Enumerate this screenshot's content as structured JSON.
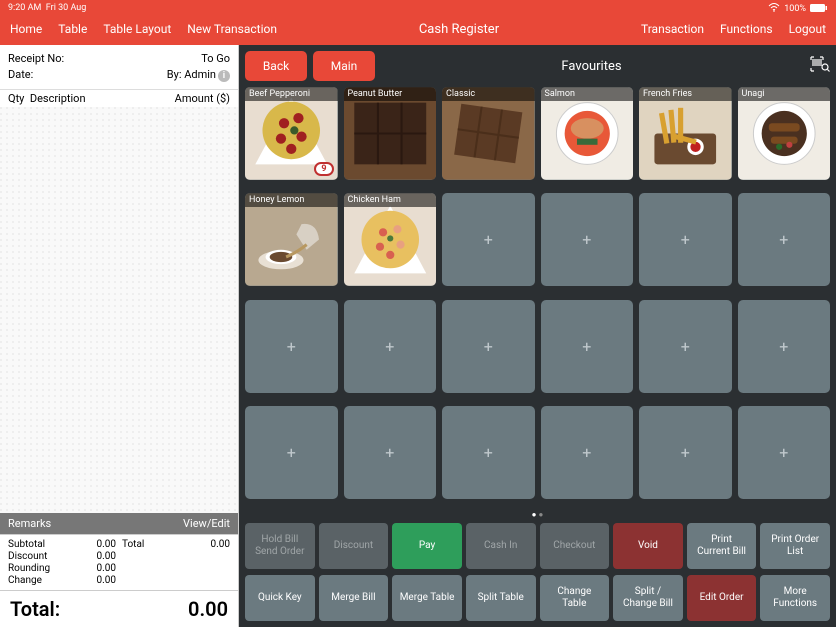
{
  "status": {
    "time": "9:20 AM",
    "date": "Fri 30 Aug",
    "battery": "100%"
  },
  "nav": {
    "left": [
      "Home",
      "Table",
      "Table Layout",
      "New Transaction"
    ],
    "title": "Cash Register",
    "right": [
      "Transaction",
      "Functions",
      "Logout"
    ]
  },
  "receipt": {
    "receipt_no_label": "Receipt No:",
    "receipt_no_value": "To Go",
    "date_label": "Date:",
    "date_value": "By: Admin",
    "qty_label": "Qty",
    "desc_label": "Description",
    "amount_label": "Amount ($)"
  },
  "remarks": {
    "label": "Remarks",
    "view_edit": "View/Edit"
  },
  "totals": {
    "subtotal_label": "Subtotal",
    "subtotal_value": "0.00",
    "discount_label": "Discount",
    "discount_value": "0.00",
    "rounding_label": "Rounding",
    "rounding_value": "0.00",
    "change_label": "Change",
    "change_value": "0.00",
    "total_label": "Total",
    "total_value": "0.00"
  },
  "grand": {
    "label": "Total:",
    "value": "0.00"
  },
  "top_buttons": {
    "back": "Back",
    "main": "Main",
    "favourites": "Favourites"
  },
  "tiles": [
    {
      "label": "Beef Pepperoni",
      "badge": "9",
      "type": "pizza"
    },
    {
      "label": "Peanut Butter",
      "type": "brownie-dark"
    },
    {
      "label": "Classic",
      "type": "brownie"
    },
    {
      "label": "Salmon",
      "type": "bowl"
    },
    {
      "label": "French Fries",
      "type": "fries"
    },
    {
      "label": "Unagi",
      "type": "bowl2"
    },
    {
      "label": "Honey Lemon",
      "type": "tea"
    },
    {
      "label": "Chicken Ham",
      "type": "pizza2"
    }
  ],
  "actions_row1": [
    {
      "label": "Hold Bill\nSend Order",
      "style": "dis"
    },
    {
      "label": "Discount",
      "style": "dis"
    },
    {
      "label": "Pay",
      "style": "green"
    },
    {
      "label": "Cash In",
      "style": "dis"
    },
    {
      "label": "Checkout",
      "style": "dis"
    },
    {
      "label": "Void",
      "style": "darkred"
    },
    {
      "label": "Print\nCurrent Bill",
      "style": "grey"
    },
    {
      "label": "Print Order\nList",
      "style": "grey"
    }
  ],
  "actions_row2": [
    {
      "label": "Quick Key",
      "style": "grey"
    },
    {
      "label": "Merge Bill",
      "style": "grey"
    },
    {
      "label": "Merge Table",
      "style": "grey"
    },
    {
      "label": "Split Table",
      "style": "grey"
    },
    {
      "label": "Change\nTable",
      "style": "grey"
    },
    {
      "label": "Split /\nChange Bill",
      "style": "grey"
    },
    {
      "label": "Edit Order",
      "style": "darkred"
    },
    {
      "label": "More\nFunctions",
      "style": "grey"
    }
  ]
}
